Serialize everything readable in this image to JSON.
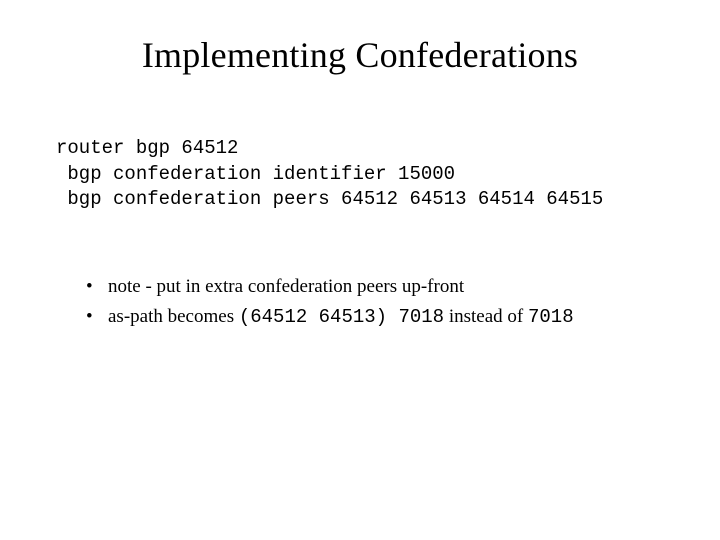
{
  "title": "Implementing Confederations",
  "code": {
    "line1": "router bgp 64512",
    "line2": " bgp confederation identifier 15000",
    "line3": " bgp confederation peers 64512 64513 64514 64515"
  },
  "notes": {
    "item1": "note - put in extra confederation peers up-front",
    "item2_prefix": "as-path becomes ",
    "item2_code1": "(64512 64513) 7018",
    "item2_mid": " instead of ",
    "item2_code2": "7018"
  }
}
